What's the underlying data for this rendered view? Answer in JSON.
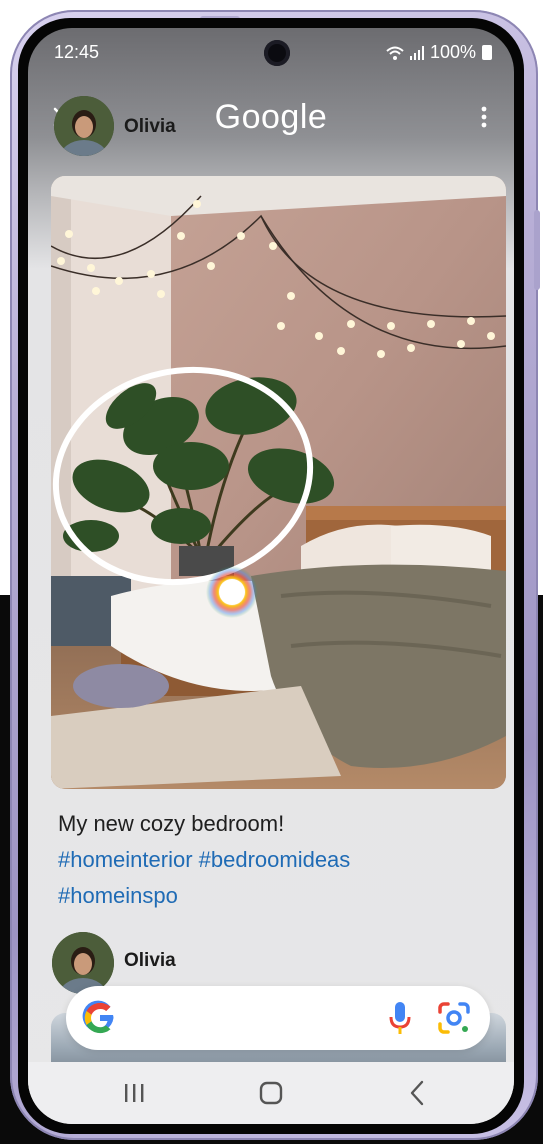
{
  "status_bar": {
    "time": "12:45",
    "battery": "100%"
  },
  "header": {
    "username": "Olivia",
    "title": "Google"
  },
  "post": {
    "caption": "My new cozy bedroom!",
    "hashtags_line1": "#homeinterior #bedroomideas",
    "hashtags_line2": "#homeinspo"
  },
  "next_post": {
    "username": "Olivia"
  },
  "search_bar": {
    "logo": "google-g-icon",
    "voice_icon": "microphone-icon",
    "lens_icon": "google-lens-icon"
  },
  "nav_bar": {
    "items": [
      "recents-icon",
      "home-icon",
      "back-icon"
    ]
  },
  "colors": {
    "hashtag": "#1f6bb5",
    "phone_frame": "#b8afd6",
    "screen_bg": "#e7e7e8"
  }
}
